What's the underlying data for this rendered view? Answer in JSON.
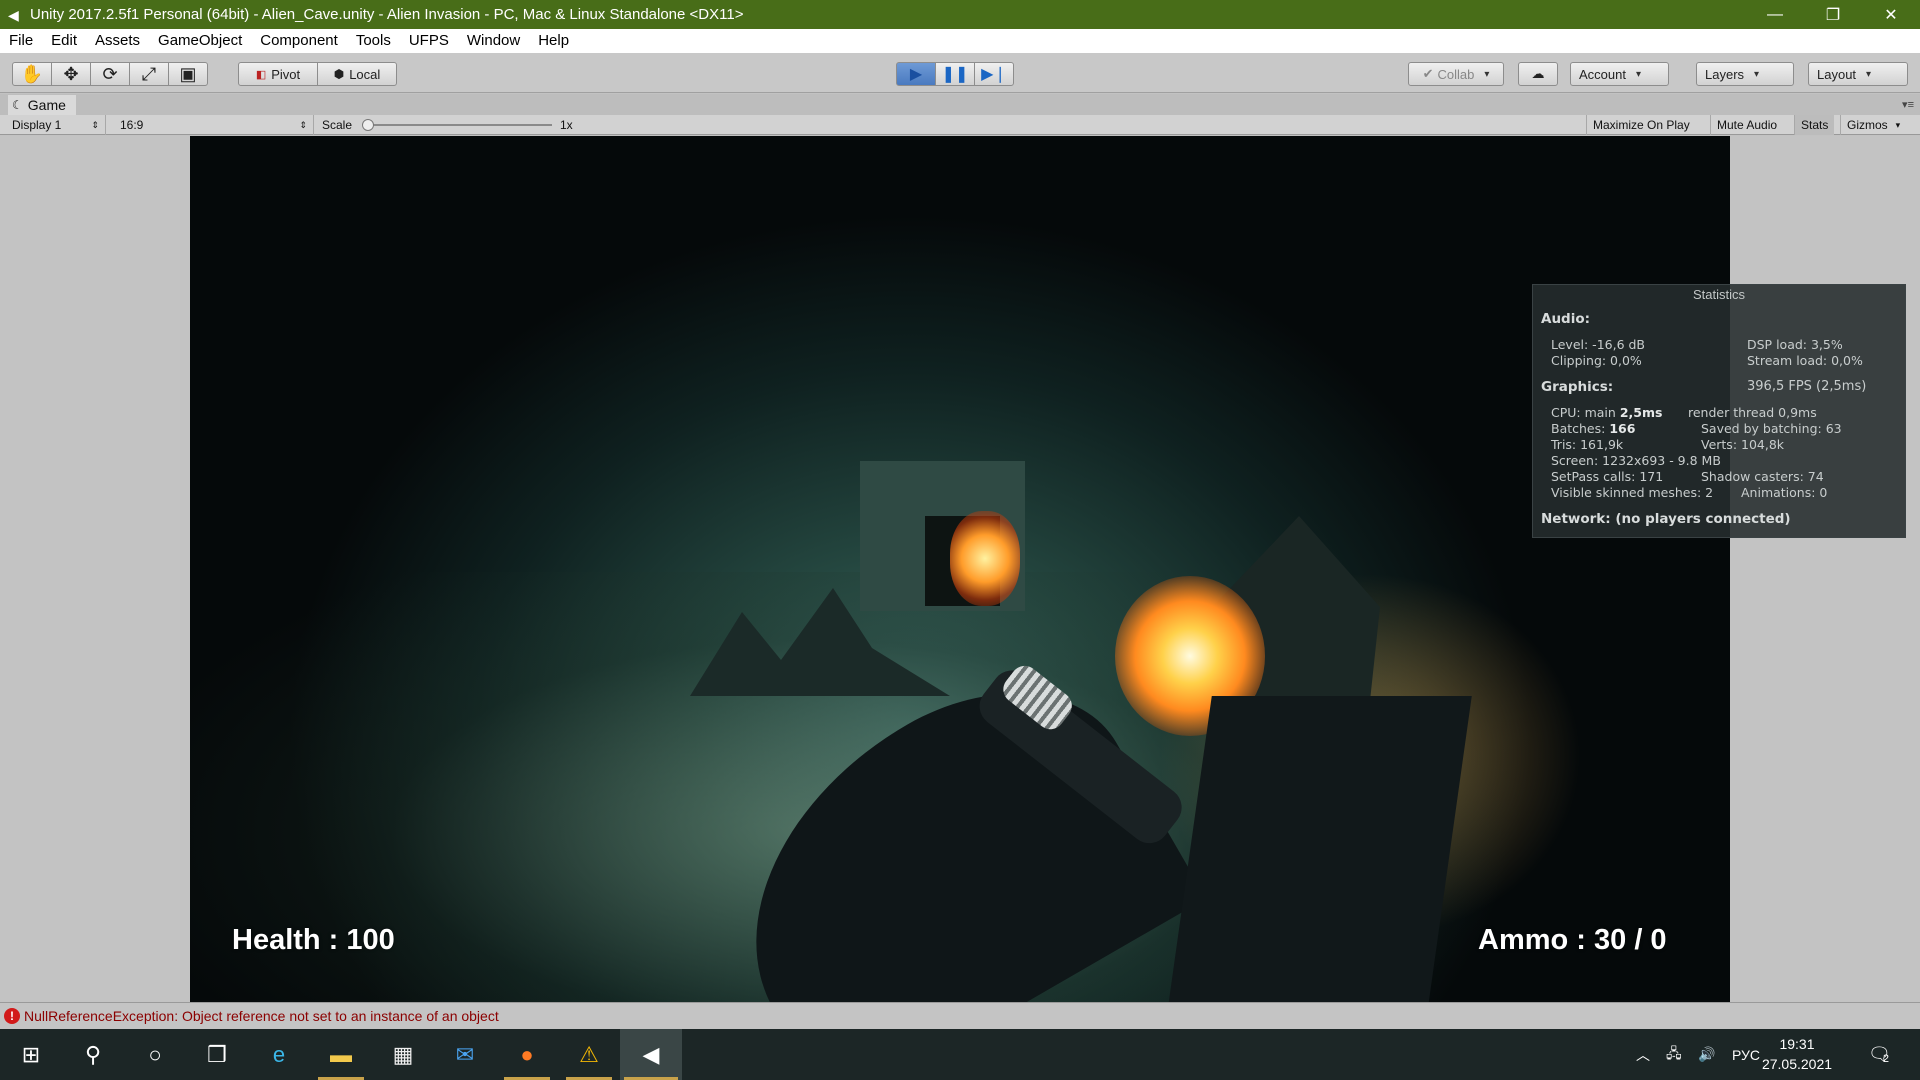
{
  "window": {
    "title": "Unity 2017.2.5f1 Personal (64bit) - Alien_Cave.unity - Alien Invasion - PC, Mac & Linux Standalone <DX11>"
  },
  "menu": [
    "File",
    "Edit",
    "Assets",
    "GameObject",
    "Component",
    "Tools",
    "UFPS",
    "Window",
    "Help"
  ],
  "toolbar": {
    "pivot": "Pivot",
    "local": "Local",
    "collab": "Collab",
    "account": "Account",
    "layers": "Layers",
    "layout": "Layout",
    "tools": [
      "hand-tool-icon",
      "move-tool-icon",
      "rotate-tool-icon",
      "scale-tool-icon",
      "rect-tool-icon"
    ]
  },
  "game_tab": {
    "label": "Game"
  },
  "game_controls": {
    "display": "Display 1",
    "aspect": "16:9",
    "scale_label": "Scale",
    "scale_value": "1x",
    "scale_fraction": 0.0,
    "maximize": "Maximize On Play",
    "mute": "Mute Audio",
    "stats": "Stats",
    "gizmos": "Gizmos"
  },
  "hud": {
    "health": "Health : 100",
    "ammo": "Ammo : 30 / 0"
  },
  "stats": {
    "title": "Statistics",
    "audio_header": "Audio:",
    "level": "Level: -16,6 dB",
    "dsp_load": "DSP load: 3,5%",
    "clipping": "Clipping: 0,0%",
    "stream_load": "Stream load: 0,0%",
    "graphics_header": "Graphics:",
    "fps": "396,5 FPS (2,5ms)",
    "cpu_prefix": "CPU: main ",
    "cpu_main": "2,5ms",
    "render_thread": "render thread 0,9ms",
    "batches_prefix": "Batches: ",
    "batches": "166",
    "saved_batching": "Saved by batching: 63",
    "tris": "Tris: 161,9k",
    "verts": "Verts: 104,8k",
    "screen": "Screen: 1232x693 - 9.8 MB",
    "setpass": "SetPass calls: 171",
    "shadow_casters": "Shadow casters: 74",
    "skinned": "Visible skinned meshes: 2",
    "animations": "Animations: 0",
    "network": "Network: (no players connected)"
  },
  "status": {
    "message": "NullReferenceException: Object reference not set to an instance of an object"
  },
  "taskbar": {
    "icons": [
      "windows-start-icon",
      "search-icon",
      "cortana-icon",
      "task-view-icon",
      "edge-icon",
      "file-explorer-icon",
      "store-icon",
      "mail-icon",
      "firefox-icon",
      "app-warning-icon",
      "unity-icon"
    ],
    "lang": "РУС",
    "time": "19:31",
    "date": "27.05.2021",
    "notifications": "2"
  },
  "colors": {
    "titlebar": "#486d18",
    "play_active": "#4a7ac0",
    "error": "#d21a1a"
  }
}
